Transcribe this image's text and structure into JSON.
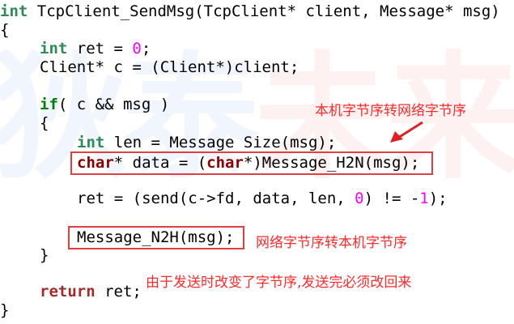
{
  "watermark": {
    "text_main": "狄泰",
    "text_accent": "未来"
  },
  "code": {
    "l1": {
      "type": "int",
      "rest": " TcpClient_SendMsg(TcpClient* client, Message* msg)"
    },
    "l2": "{",
    "l3": {
      "type": "int",
      "mid": " ret = ",
      "num": "0",
      "end": ";"
    },
    "l4": "Client* c = (Client*)client;",
    "l5": {
      "kw": "if",
      "rest": "( c && msg )"
    },
    "l6": "{",
    "l7": {
      "type": "int",
      "rest": " len = Message Size(msg);"
    },
    "l8": {
      "t1": "char",
      "mid": "* data = (",
      "t2": "char",
      "end": "*)Message_H2N(msg);"
    },
    "l9": {
      "a": "ret = (send(c->fd, data, len, ",
      "n1": "0",
      "b": ") != -",
      "n2": "1",
      "c": ");"
    },
    "l10": "Message_N2H(msg);",
    "l11": "}",
    "l12": {
      "kw": "return",
      "rest": " ret;"
    },
    "l13": "}"
  },
  "annotations": {
    "h2n": "本机字节序转网络字节序",
    "n2h": "网络字节序转本机字节序",
    "restore": "由于发送时改变了字节序,发送完必须改回来"
  },
  "colors": {
    "annotation": "#ff2a2a",
    "keyword": "#008000",
    "char_type": "#8b0000",
    "number": "#ff00ff"
  }
}
